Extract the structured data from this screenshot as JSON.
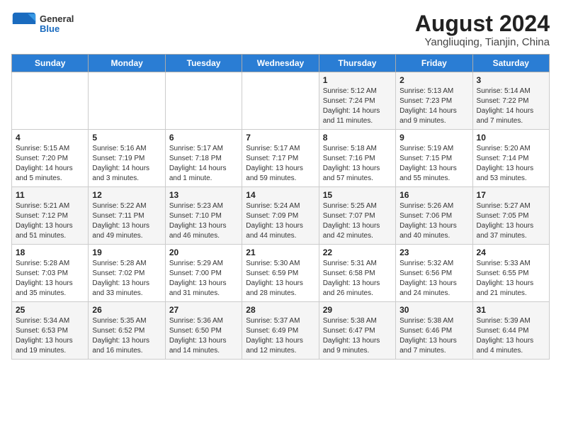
{
  "header": {
    "logo_general": "General",
    "logo_blue": "Blue",
    "month_year": "August 2024",
    "location": "Yangliuqing, Tianjin, China"
  },
  "weekdays": [
    "Sunday",
    "Monday",
    "Tuesday",
    "Wednesday",
    "Thursday",
    "Friday",
    "Saturday"
  ],
  "weeks": [
    [
      {
        "day": "",
        "info": ""
      },
      {
        "day": "",
        "info": ""
      },
      {
        "day": "",
        "info": ""
      },
      {
        "day": "",
        "info": ""
      },
      {
        "day": "1",
        "info": "Sunrise: 5:12 AM\nSunset: 7:24 PM\nDaylight: 14 hours\nand 11 minutes."
      },
      {
        "day": "2",
        "info": "Sunrise: 5:13 AM\nSunset: 7:23 PM\nDaylight: 14 hours\nand 9 minutes."
      },
      {
        "day": "3",
        "info": "Sunrise: 5:14 AM\nSunset: 7:22 PM\nDaylight: 14 hours\nand 7 minutes."
      }
    ],
    [
      {
        "day": "4",
        "info": "Sunrise: 5:15 AM\nSunset: 7:20 PM\nDaylight: 14 hours\nand 5 minutes."
      },
      {
        "day": "5",
        "info": "Sunrise: 5:16 AM\nSunset: 7:19 PM\nDaylight: 14 hours\nand 3 minutes."
      },
      {
        "day": "6",
        "info": "Sunrise: 5:17 AM\nSunset: 7:18 PM\nDaylight: 14 hours\nand 1 minute."
      },
      {
        "day": "7",
        "info": "Sunrise: 5:17 AM\nSunset: 7:17 PM\nDaylight: 13 hours\nand 59 minutes."
      },
      {
        "day": "8",
        "info": "Sunrise: 5:18 AM\nSunset: 7:16 PM\nDaylight: 13 hours\nand 57 minutes."
      },
      {
        "day": "9",
        "info": "Sunrise: 5:19 AM\nSunset: 7:15 PM\nDaylight: 13 hours\nand 55 minutes."
      },
      {
        "day": "10",
        "info": "Sunrise: 5:20 AM\nSunset: 7:14 PM\nDaylight: 13 hours\nand 53 minutes."
      }
    ],
    [
      {
        "day": "11",
        "info": "Sunrise: 5:21 AM\nSunset: 7:12 PM\nDaylight: 13 hours\nand 51 minutes."
      },
      {
        "day": "12",
        "info": "Sunrise: 5:22 AM\nSunset: 7:11 PM\nDaylight: 13 hours\nand 49 minutes."
      },
      {
        "day": "13",
        "info": "Sunrise: 5:23 AM\nSunset: 7:10 PM\nDaylight: 13 hours\nand 46 minutes."
      },
      {
        "day": "14",
        "info": "Sunrise: 5:24 AM\nSunset: 7:09 PM\nDaylight: 13 hours\nand 44 minutes."
      },
      {
        "day": "15",
        "info": "Sunrise: 5:25 AM\nSunset: 7:07 PM\nDaylight: 13 hours\nand 42 minutes."
      },
      {
        "day": "16",
        "info": "Sunrise: 5:26 AM\nSunset: 7:06 PM\nDaylight: 13 hours\nand 40 minutes."
      },
      {
        "day": "17",
        "info": "Sunrise: 5:27 AM\nSunset: 7:05 PM\nDaylight: 13 hours\nand 37 minutes."
      }
    ],
    [
      {
        "day": "18",
        "info": "Sunrise: 5:28 AM\nSunset: 7:03 PM\nDaylight: 13 hours\nand 35 minutes."
      },
      {
        "day": "19",
        "info": "Sunrise: 5:28 AM\nSunset: 7:02 PM\nDaylight: 13 hours\nand 33 minutes."
      },
      {
        "day": "20",
        "info": "Sunrise: 5:29 AM\nSunset: 7:00 PM\nDaylight: 13 hours\nand 31 minutes."
      },
      {
        "day": "21",
        "info": "Sunrise: 5:30 AM\nSunset: 6:59 PM\nDaylight: 13 hours\nand 28 minutes."
      },
      {
        "day": "22",
        "info": "Sunrise: 5:31 AM\nSunset: 6:58 PM\nDaylight: 13 hours\nand 26 minutes."
      },
      {
        "day": "23",
        "info": "Sunrise: 5:32 AM\nSunset: 6:56 PM\nDaylight: 13 hours\nand 24 minutes."
      },
      {
        "day": "24",
        "info": "Sunrise: 5:33 AM\nSunset: 6:55 PM\nDaylight: 13 hours\nand 21 minutes."
      }
    ],
    [
      {
        "day": "25",
        "info": "Sunrise: 5:34 AM\nSunset: 6:53 PM\nDaylight: 13 hours\nand 19 minutes."
      },
      {
        "day": "26",
        "info": "Sunrise: 5:35 AM\nSunset: 6:52 PM\nDaylight: 13 hours\nand 16 minutes."
      },
      {
        "day": "27",
        "info": "Sunrise: 5:36 AM\nSunset: 6:50 PM\nDaylight: 13 hours\nand 14 minutes."
      },
      {
        "day": "28",
        "info": "Sunrise: 5:37 AM\nSunset: 6:49 PM\nDaylight: 13 hours\nand 12 minutes."
      },
      {
        "day": "29",
        "info": "Sunrise: 5:38 AM\nSunset: 6:47 PM\nDaylight: 13 hours\nand 9 minutes."
      },
      {
        "day": "30",
        "info": "Sunrise: 5:38 AM\nSunset: 6:46 PM\nDaylight: 13 hours\nand 7 minutes."
      },
      {
        "day": "31",
        "info": "Sunrise: 5:39 AM\nSunset: 6:44 PM\nDaylight: 13 hours\nand 4 minutes."
      }
    ]
  ]
}
